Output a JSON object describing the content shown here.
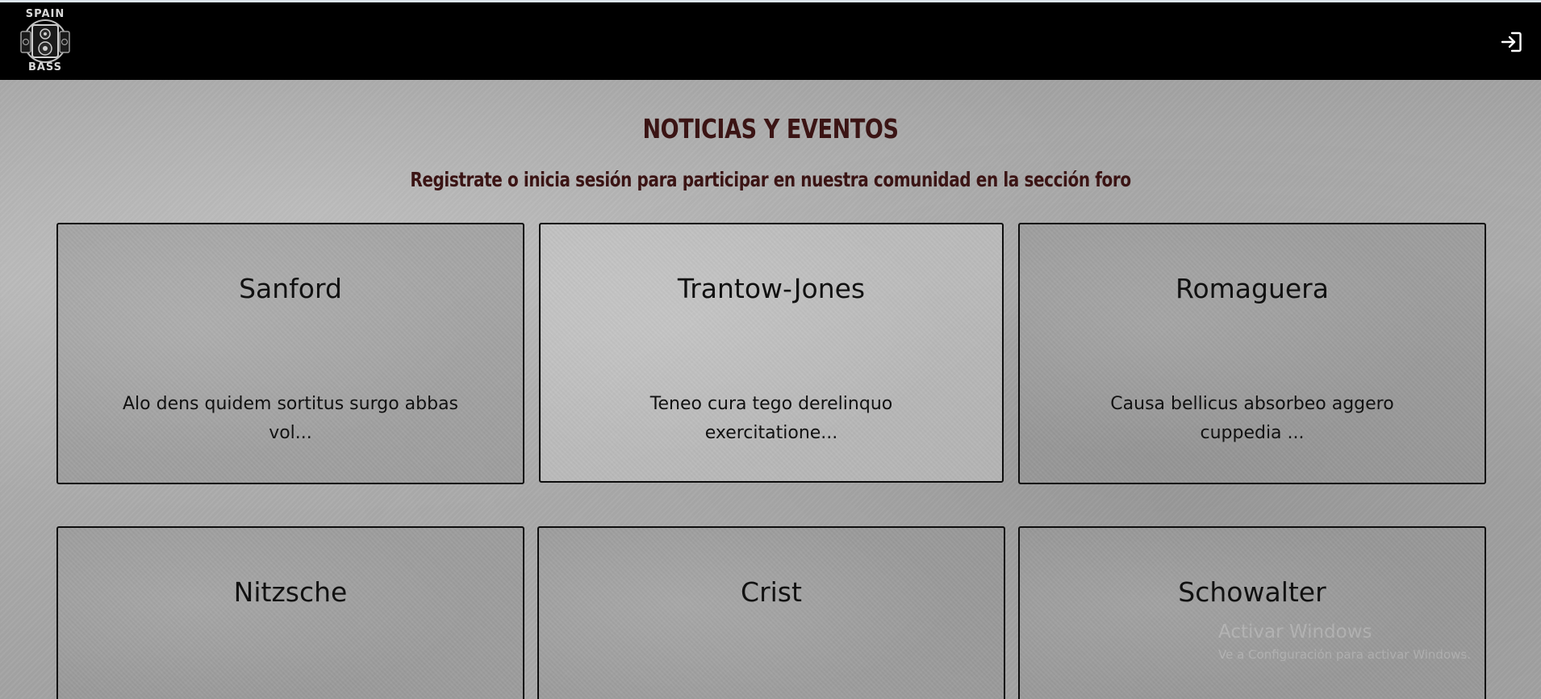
{
  "header": {
    "logo": {
      "top_text": "SPAIN",
      "bottom_text": "BASS"
    },
    "login_icon": "login-icon"
  },
  "main": {
    "title": "NOTICIAS Y EVENTOS",
    "subtitle": "Registrate o inicia sesión para participar en nuestra comunidad en la sección foro",
    "cards": [
      {
        "title": "Sanford",
        "description": "Alo dens quidem sortitus surgo abbas vol..."
      },
      {
        "title": "Trantow-Jones",
        "description": "Teneo cura tego derelinquo exercitatione..."
      },
      {
        "title": "Romaguera",
        "description": "Causa bellicus absorbeo aggero cuppedia ..."
      },
      {
        "title": "Nitzsche",
        "description": ""
      },
      {
        "title": "Crist",
        "description": ""
      },
      {
        "title": "Schowalter",
        "description": ""
      }
    ]
  },
  "watermark": {
    "title": "Activar Windows",
    "subtitle": "Ve a Configuración para activar Windows."
  },
  "colors": {
    "navbar": "#000000",
    "heading": "#3b1414",
    "card_border": "#0d0d0d"
  }
}
